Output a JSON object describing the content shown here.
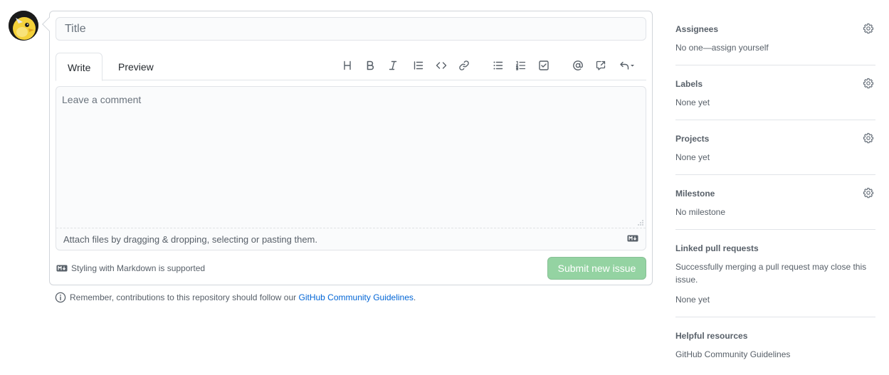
{
  "form": {
    "title_placeholder": "Title",
    "tabs": [
      {
        "label": "Write"
      },
      {
        "label": "Preview"
      }
    ],
    "toolbar": [
      {
        "icon": "heading-icon"
      },
      {
        "icon": "bold-icon"
      },
      {
        "icon": "italic-icon"
      },
      {
        "icon": "quote-icon"
      },
      {
        "icon": "code-icon"
      },
      {
        "icon": "link-icon"
      },
      {
        "icon": "bulleted-list-icon"
      },
      {
        "icon": "numbered-list-icon"
      },
      {
        "icon": "task-list-icon"
      },
      {
        "icon": "mention-icon"
      },
      {
        "icon": "cross-reference-icon"
      },
      {
        "icon": "saved-replies-icon"
      }
    ],
    "comment_placeholder": "Leave a comment",
    "attach_text": "Attach files by dragging & dropping, selecting or pasting them.",
    "markdown_hint": "Styling with Markdown is supported",
    "submit_label": "Submit new issue",
    "submit_color": "#94d3a2"
  },
  "note": {
    "text": "Remember, contributions to this repository should follow our",
    "link": "GitHub Community Guidelines",
    "suffix": "."
  },
  "sidebar": {
    "assignees": {
      "heading": "Assignees",
      "value": "No one—assign yourself"
    },
    "labels": {
      "heading": "Labels",
      "value": "None yet"
    },
    "projects": {
      "heading": "Projects",
      "value": "None yet"
    },
    "milestone": {
      "heading": "Milestone",
      "value": "No milestone"
    },
    "linked_prs": {
      "heading": "Linked pull requests",
      "description": "Successfully merging a pull request may close this issue.",
      "value": "None yet"
    },
    "helpful": {
      "heading": "Helpful resources",
      "link": "GitHub Community Guidelines"
    }
  },
  "colors": {
    "link": "#0366d6",
    "muted_text": "#586069",
    "border": "#d1d5da"
  }
}
